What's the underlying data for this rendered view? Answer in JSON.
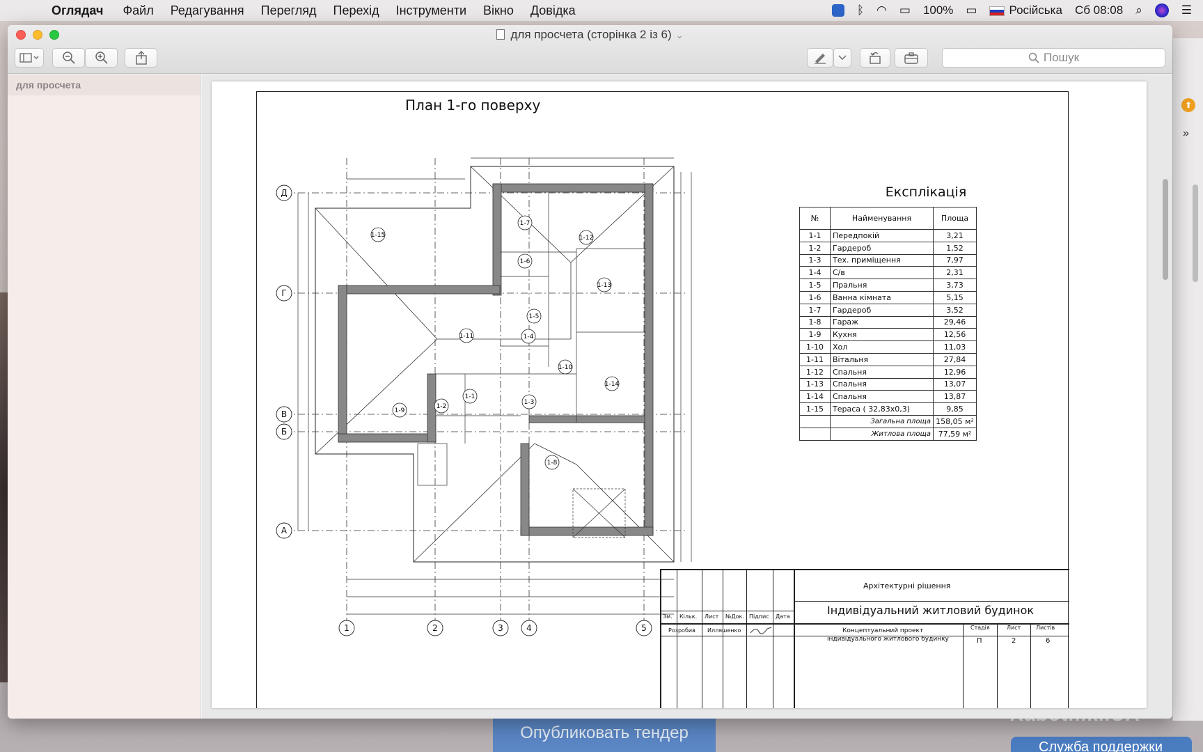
{
  "menubar": {
    "app": "Оглядач",
    "items": [
      "Файл",
      "Редагування",
      "Перегляд",
      "Перехід",
      "Інструменти",
      "Вікно",
      "Довідка"
    ],
    "battery": "100%",
    "language": "Російська",
    "clock": "Сб 08:08"
  },
  "window": {
    "title": "для просчета (сторінка 2 із 6)",
    "search_placeholder": "Пошук",
    "sidebar_header": "для просчета"
  },
  "drawing": {
    "title": "План 1-го поверху",
    "explication_title": "Експлікація",
    "table_headers": [
      "№",
      "Найменування",
      "Площа"
    ],
    "rooms": [
      [
        "1-1",
        "Передпокій",
        "3,21"
      ],
      [
        "1-2",
        "Гардероб",
        "1,52"
      ],
      [
        "1-3",
        "Тех. приміщення",
        "7,97"
      ],
      [
        "1-4",
        "С/в",
        "2,31"
      ],
      [
        "1-5",
        "Пральня",
        "3,73"
      ],
      [
        "1-6",
        "Ванна кімната",
        "5,15"
      ],
      [
        "1-7",
        "Гардероб",
        "3,52"
      ],
      [
        "1-8",
        "Гараж",
        "29,46"
      ],
      [
        "1-9",
        "Кухня",
        "12,56"
      ],
      [
        "1-10",
        "Хол",
        "11,03"
      ],
      [
        "1-11",
        "Вітальня",
        "27,84"
      ],
      [
        "1-12",
        "Спальня",
        "12,96"
      ],
      [
        "1-13",
        "Спальня",
        "13,07"
      ],
      [
        "1-14",
        "Спальня",
        "13,87"
      ],
      [
        "1-15",
        "Тераса ( 32,83х0,3)",
        "9,85"
      ]
    ],
    "total_label": "Загальна площа",
    "total_value": "158,05 м²",
    "living_label": "Житлова площа",
    "living_value": "77,59 м²",
    "axes_letters": [
      "Д",
      "Г",
      "В",
      "Б",
      "А"
    ],
    "axes_numbers": [
      "1",
      "2",
      "3",
      "4",
      "5"
    ],
    "room_tags": [
      "1-15",
      "1-7",
      "1-12",
      "1-6",
      "1-13",
      "1-5",
      "1-11",
      "1-4",
      "1-10",
      "1-14",
      "1-1",
      "1-3",
      "1-2",
      "1-9",
      "1-8"
    ],
    "title_block": {
      "section": "Архітектурні рішення",
      "name": "Індивідуальний житловий будинок",
      "project": "Концептуальний проект",
      "project2": "індивідуального житлового будинку",
      "cols": [
        "Зм.",
        "Кільк.",
        "Лист",
        "№Док.",
        "Підпис",
        "Дата"
      ],
      "developed": "Розробив",
      "author": "Илляшенко",
      "stage_labels": [
        "Стадія",
        "Лист",
        "Листів"
      ],
      "stage_values": [
        "П",
        "2",
        "6"
      ]
    }
  },
  "background": {
    "publish_button": "Опубликовать тендер",
    "support_button": "Служба поддержки",
    "watermark": "Rabotniki.UA"
  }
}
